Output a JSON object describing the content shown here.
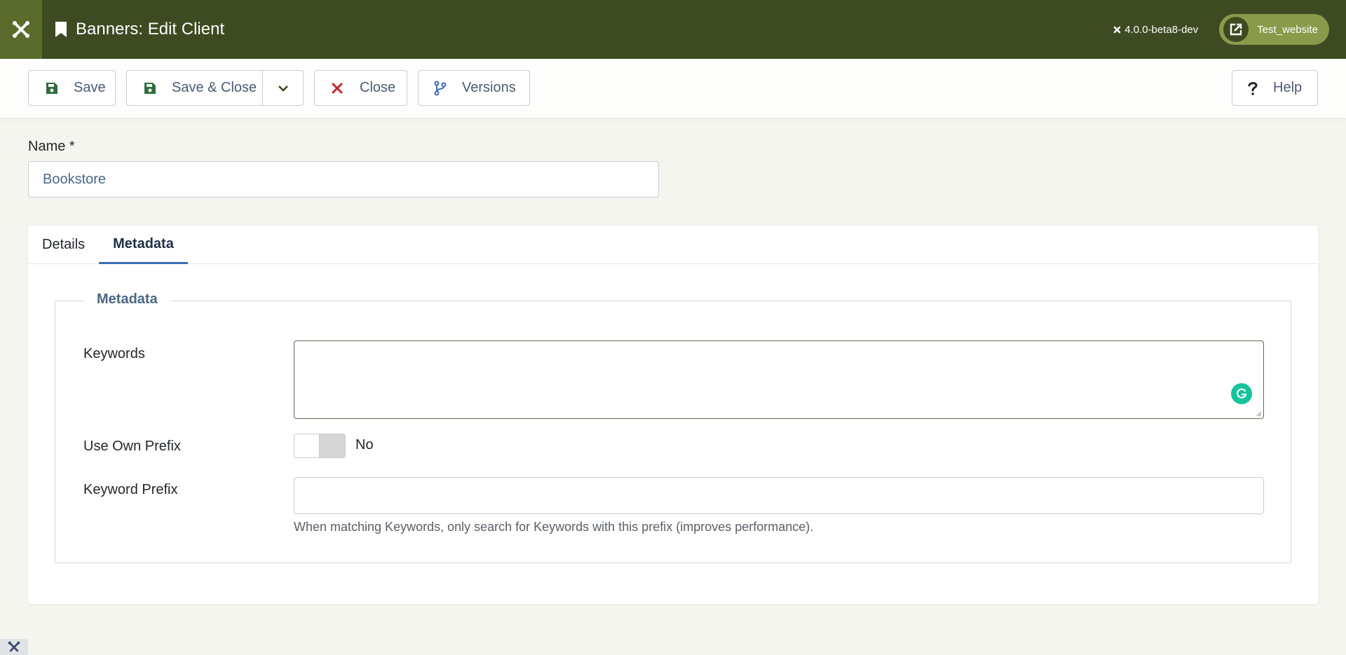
{
  "header": {
    "title": "Banners: Edit Client",
    "version": "4.0.0-beta8-dev",
    "site_link": "Test_website"
  },
  "toolbar": {
    "save": "Save",
    "save_close": "Save & Close",
    "close": "Close",
    "versions": "Versions",
    "help": "Help"
  },
  "form": {
    "name_label": "Name *",
    "name_value": "Bookstore"
  },
  "tabs": [
    {
      "label": "Details",
      "active": false
    },
    {
      "label": "Metadata",
      "active": true
    }
  ],
  "metadata": {
    "legend": "Metadata",
    "keywords_label": "Keywords",
    "keywords_value": "",
    "own_prefix_label": "Use Own Prefix",
    "own_prefix_value": "No",
    "keyword_prefix_label": "Keyword Prefix",
    "keyword_prefix_value": "",
    "keyword_prefix_hint": "When matching Keywords, only search for Keywords with this prefix (improves performance)."
  },
  "colors": {
    "header_bg": "#3e4a21",
    "logo_bg": "#5b6b2b",
    "site_button": "#8a9a4a",
    "tab_active": "#3d6cb0",
    "close_icon": "#c52827",
    "save_icon": "#2f6d3d",
    "grammarly": "#15c39a"
  },
  "icons": {
    "header_logo": "joomla-icon",
    "title_icon": "bookmark-icon",
    "site_icon": "external-link-icon",
    "save_icon": "floppy-disk-icon",
    "dropdown_icon": "chevron-down-icon",
    "close_icon": "x-icon",
    "versions_icon": "code-branch-icon",
    "help_icon": "question-icon",
    "grammarly_icon": "grammarly-icon"
  }
}
